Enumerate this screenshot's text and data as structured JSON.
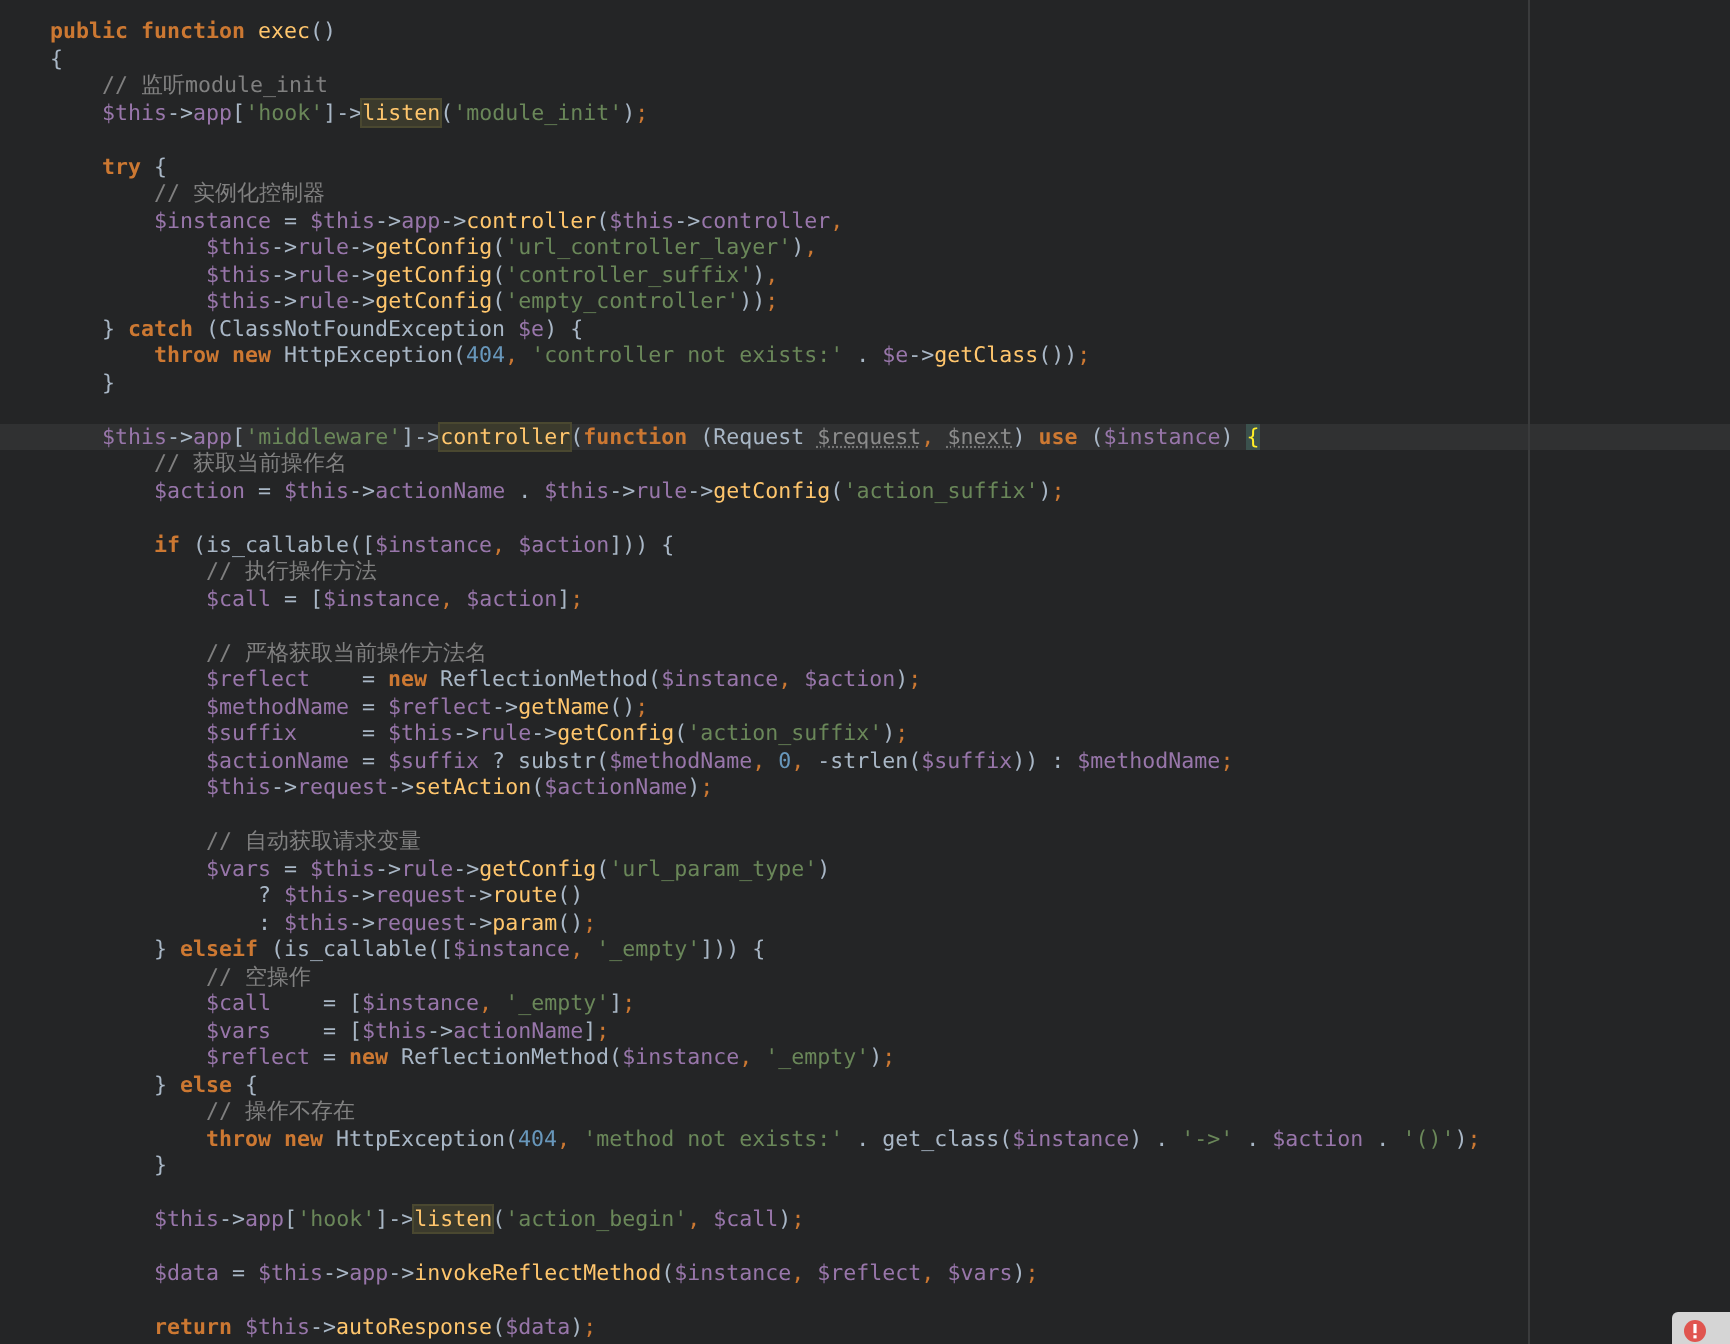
{
  "editor": {
    "lines": [
      {
        "current": false,
        "tokens": [
          {
            "kind": "kw",
            "t": "public function "
          },
          {
            "kind": "fn",
            "t": "exec"
          },
          {
            "kind": "pl",
            "t": "()"
          }
        ]
      },
      {
        "current": false,
        "tokens": [
          {
            "kind": "pl",
            "t": "{"
          }
        ]
      },
      {
        "current": false,
        "tokens": [
          {
            "kind": "cmt",
            "t": "    // 监听module_init"
          }
        ]
      },
      {
        "current": false,
        "tokens": [
          {
            "kind": "var",
            "t": "    $this"
          },
          {
            "kind": "pl",
            "t": "->"
          },
          {
            "kind": "var",
            "t": "app"
          },
          {
            "kind": "pl",
            "t": "["
          },
          {
            "kind": "str",
            "t": "'hook'"
          },
          {
            "kind": "pl",
            "t": "]->"
          },
          {
            "kind": "hl",
            "t": "listen"
          },
          {
            "kind": "pl",
            "t": "("
          },
          {
            "kind": "str",
            "t": "'module_init'"
          },
          {
            "kind": "pl",
            "t": ")"
          },
          {
            "kind": "p",
            "t": ";"
          }
        ]
      },
      {
        "current": false
      },
      {
        "current": false,
        "tokens": [
          {
            "kind": "kw",
            "t": "    try "
          },
          {
            "kind": "pl",
            "t": "{"
          }
        ]
      },
      {
        "current": false,
        "tokens": [
          {
            "kind": "cmt",
            "t": "        // 实例化控制器"
          }
        ]
      },
      {
        "current": false,
        "tokens": [
          {
            "kind": "var",
            "t": "        $instance"
          },
          {
            "kind": "pl",
            "t": " = "
          },
          {
            "kind": "var",
            "t": "$this"
          },
          {
            "kind": "pl",
            "t": "->"
          },
          {
            "kind": "var",
            "t": "app"
          },
          {
            "kind": "pl",
            "t": "->"
          },
          {
            "kind": "fn",
            "t": "controller"
          },
          {
            "kind": "pl",
            "t": "("
          },
          {
            "kind": "var",
            "t": "$this"
          },
          {
            "kind": "pl",
            "t": "->"
          },
          {
            "kind": "var",
            "t": "controller"
          },
          {
            "kind": "p",
            "t": ","
          }
        ]
      },
      {
        "current": false,
        "tokens": [
          {
            "kind": "var",
            "t": "            $this"
          },
          {
            "kind": "pl",
            "t": "->"
          },
          {
            "kind": "var",
            "t": "rule"
          },
          {
            "kind": "pl",
            "t": "->"
          },
          {
            "kind": "fn",
            "t": "getConfig"
          },
          {
            "kind": "pl",
            "t": "("
          },
          {
            "kind": "str",
            "t": "'url_controller_layer'"
          },
          {
            "kind": "pl",
            "t": ")"
          },
          {
            "kind": "p",
            "t": ","
          }
        ]
      },
      {
        "current": false,
        "tokens": [
          {
            "kind": "var",
            "t": "            $this"
          },
          {
            "kind": "pl",
            "t": "->"
          },
          {
            "kind": "var",
            "t": "rule"
          },
          {
            "kind": "pl",
            "t": "->"
          },
          {
            "kind": "fn",
            "t": "getConfig"
          },
          {
            "kind": "pl",
            "t": "("
          },
          {
            "kind": "str",
            "t": "'controller_suffix'"
          },
          {
            "kind": "pl",
            "t": ")"
          },
          {
            "kind": "p",
            "t": ","
          }
        ]
      },
      {
        "current": false,
        "tokens": [
          {
            "kind": "var",
            "t": "            $this"
          },
          {
            "kind": "pl",
            "t": "->"
          },
          {
            "kind": "var",
            "t": "rule"
          },
          {
            "kind": "pl",
            "t": "->"
          },
          {
            "kind": "fn",
            "t": "getConfig"
          },
          {
            "kind": "pl",
            "t": "("
          },
          {
            "kind": "str",
            "t": "'empty_controller'"
          },
          {
            "kind": "pl",
            "t": "))"
          },
          {
            "kind": "p",
            "t": ";"
          }
        ]
      },
      {
        "current": false,
        "tokens": [
          {
            "kind": "pl",
            "t": "    } "
          },
          {
            "kind": "kw",
            "t": "catch "
          },
          {
            "kind": "pl",
            "t": "(ClassNotFoundException "
          },
          {
            "kind": "var",
            "t": "$e"
          },
          {
            "kind": "pl",
            "t": ") {"
          }
        ]
      },
      {
        "current": false,
        "tokens": [
          {
            "kind": "kw",
            "t": "        throw new "
          },
          {
            "kind": "pl",
            "t": "HttpException("
          },
          {
            "kind": "num",
            "t": "404"
          },
          {
            "kind": "p",
            "t": ", "
          },
          {
            "kind": "str",
            "t": "'controller not exists:'"
          },
          {
            "kind": "pl",
            "t": " . "
          },
          {
            "kind": "var",
            "t": "$e"
          },
          {
            "kind": "pl",
            "t": "->"
          },
          {
            "kind": "fn",
            "t": "getClass"
          },
          {
            "kind": "pl",
            "t": "())"
          },
          {
            "kind": "p",
            "t": ";"
          }
        ]
      },
      {
        "current": false,
        "tokens": [
          {
            "kind": "pl",
            "t": "    }"
          }
        ]
      },
      {
        "current": false
      },
      {
        "current": true,
        "tokens": [
          {
            "kind": "var",
            "t": "    $this"
          },
          {
            "kind": "pl",
            "t": "->"
          },
          {
            "kind": "var",
            "t": "app"
          },
          {
            "kind": "pl",
            "t": "["
          },
          {
            "kind": "str",
            "t": "'middleware'"
          },
          {
            "kind": "pl",
            "t": "]->"
          },
          {
            "kind": "hl",
            "t": "controller"
          },
          {
            "kind": "pl",
            "t": "("
          },
          {
            "kind": "kw",
            "t": "function "
          },
          {
            "kind": "pl",
            "t": "(Request "
          },
          {
            "kind": "un",
            "t": "$request"
          },
          {
            "kind": "p",
            "t": ", "
          },
          {
            "kind": "un",
            "t": "$next"
          },
          {
            "kind": "pl",
            "t": ") "
          },
          {
            "kind": "kw",
            "t": "use "
          },
          {
            "kind": "pl",
            "t": "("
          },
          {
            "kind": "var",
            "t": "$instance"
          },
          {
            "kind": "pl",
            "t": ") "
          },
          {
            "kind": "br",
            "t": "{"
          }
        ]
      },
      {
        "current": false,
        "tokens": [
          {
            "kind": "cmt",
            "t": "        // 获取当前操作名"
          }
        ]
      },
      {
        "current": false,
        "tokens": [
          {
            "kind": "var",
            "t": "        $action"
          },
          {
            "kind": "pl",
            "t": " = "
          },
          {
            "kind": "var",
            "t": "$this"
          },
          {
            "kind": "pl",
            "t": "->"
          },
          {
            "kind": "var",
            "t": "actionName"
          },
          {
            "kind": "pl",
            "t": " . "
          },
          {
            "kind": "var",
            "t": "$this"
          },
          {
            "kind": "pl",
            "t": "->"
          },
          {
            "kind": "var",
            "t": "rule"
          },
          {
            "kind": "pl",
            "t": "->"
          },
          {
            "kind": "fn",
            "t": "getConfig"
          },
          {
            "kind": "pl",
            "t": "("
          },
          {
            "kind": "str",
            "t": "'action_suffix'"
          },
          {
            "kind": "pl",
            "t": ")"
          },
          {
            "kind": "p",
            "t": ";"
          }
        ]
      },
      {
        "current": false
      },
      {
        "current": false,
        "tokens": [
          {
            "kind": "kw",
            "t": "        if "
          },
          {
            "kind": "pl",
            "t": "(is_callable(["
          },
          {
            "kind": "var",
            "t": "$instance"
          },
          {
            "kind": "p",
            "t": ", "
          },
          {
            "kind": "var",
            "t": "$action"
          },
          {
            "kind": "pl",
            "t": "])) {"
          }
        ]
      },
      {
        "current": false,
        "tokens": [
          {
            "kind": "cmt",
            "t": "            // 执行操作方法"
          }
        ]
      },
      {
        "current": false,
        "tokens": [
          {
            "kind": "var",
            "t": "            $call"
          },
          {
            "kind": "pl",
            "t": " = ["
          },
          {
            "kind": "var",
            "t": "$instance"
          },
          {
            "kind": "p",
            "t": ", "
          },
          {
            "kind": "var",
            "t": "$action"
          },
          {
            "kind": "pl",
            "t": "]"
          },
          {
            "kind": "p",
            "t": ";"
          }
        ]
      },
      {
        "current": false
      },
      {
        "current": false,
        "tokens": [
          {
            "kind": "cmt",
            "t": "            // 严格获取当前操作方法名"
          }
        ]
      },
      {
        "current": false,
        "tokens": [
          {
            "kind": "var",
            "t": "            $reflect"
          },
          {
            "kind": "pl",
            "t": "    = "
          },
          {
            "kind": "kw",
            "t": "new "
          },
          {
            "kind": "pl",
            "t": "ReflectionMethod("
          },
          {
            "kind": "var",
            "t": "$instance"
          },
          {
            "kind": "p",
            "t": ", "
          },
          {
            "kind": "var",
            "t": "$action"
          },
          {
            "kind": "pl",
            "t": ")"
          },
          {
            "kind": "p",
            "t": ";"
          }
        ]
      },
      {
        "current": false,
        "tokens": [
          {
            "kind": "var",
            "t": "            $methodName"
          },
          {
            "kind": "pl",
            "t": " = "
          },
          {
            "kind": "var",
            "t": "$reflect"
          },
          {
            "kind": "pl",
            "t": "->"
          },
          {
            "kind": "fn",
            "t": "getName"
          },
          {
            "kind": "pl",
            "t": "()"
          },
          {
            "kind": "p",
            "t": ";"
          }
        ]
      },
      {
        "current": false,
        "tokens": [
          {
            "kind": "var",
            "t": "            $suffix"
          },
          {
            "kind": "pl",
            "t": "     = "
          },
          {
            "kind": "var",
            "t": "$this"
          },
          {
            "kind": "pl",
            "t": "->"
          },
          {
            "kind": "var",
            "t": "rule"
          },
          {
            "kind": "pl",
            "t": "->"
          },
          {
            "kind": "fn",
            "t": "getConfig"
          },
          {
            "kind": "pl",
            "t": "("
          },
          {
            "kind": "str",
            "t": "'action_suffix'"
          },
          {
            "kind": "pl",
            "t": ")"
          },
          {
            "kind": "p",
            "t": ";"
          }
        ]
      },
      {
        "current": false,
        "tokens": [
          {
            "kind": "var",
            "t": "            $actionName"
          },
          {
            "kind": "pl",
            "t": " = "
          },
          {
            "kind": "var",
            "t": "$suffix"
          },
          {
            "kind": "pl",
            "t": " ? substr("
          },
          {
            "kind": "var",
            "t": "$methodName"
          },
          {
            "kind": "p",
            "t": ", "
          },
          {
            "kind": "num",
            "t": "0"
          },
          {
            "kind": "p",
            "t": ", "
          },
          {
            "kind": "pl",
            "t": "-strlen("
          },
          {
            "kind": "var",
            "t": "$suffix"
          },
          {
            "kind": "pl",
            "t": ")) : "
          },
          {
            "kind": "var",
            "t": "$methodName"
          },
          {
            "kind": "p",
            "t": ";"
          }
        ]
      },
      {
        "current": false,
        "tokens": [
          {
            "kind": "var",
            "t": "            $this"
          },
          {
            "kind": "pl",
            "t": "->"
          },
          {
            "kind": "var",
            "t": "request"
          },
          {
            "kind": "pl",
            "t": "->"
          },
          {
            "kind": "fn",
            "t": "setAction"
          },
          {
            "kind": "pl",
            "t": "("
          },
          {
            "kind": "var",
            "t": "$actionName"
          },
          {
            "kind": "pl",
            "t": ")"
          },
          {
            "kind": "p",
            "t": ";"
          }
        ]
      },
      {
        "current": false
      },
      {
        "current": false,
        "tokens": [
          {
            "kind": "cmt",
            "t": "            // 自动获取请求变量"
          }
        ]
      },
      {
        "current": false,
        "tokens": [
          {
            "kind": "var",
            "t": "            $vars"
          },
          {
            "kind": "pl",
            "t": " = "
          },
          {
            "kind": "var",
            "t": "$this"
          },
          {
            "kind": "pl",
            "t": "->"
          },
          {
            "kind": "var",
            "t": "rule"
          },
          {
            "kind": "pl",
            "t": "->"
          },
          {
            "kind": "fn",
            "t": "getConfig"
          },
          {
            "kind": "pl",
            "t": "("
          },
          {
            "kind": "str",
            "t": "'url_param_type'"
          },
          {
            "kind": "pl",
            "t": ")"
          }
        ]
      },
      {
        "current": false,
        "tokens": [
          {
            "kind": "pl",
            "t": "                ? "
          },
          {
            "kind": "var",
            "t": "$this"
          },
          {
            "kind": "pl",
            "t": "->"
          },
          {
            "kind": "var",
            "t": "request"
          },
          {
            "kind": "pl",
            "t": "->"
          },
          {
            "kind": "fn",
            "t": "route"
          },
          {
            "kind": "pl",
            "t": "()"
          }
        ]
      },
      {
        "current": false,
        "tokens": [
          {
            "kind": "pl",
            "t": "                : "
          },
          {
            "kind": "var",
            "t": "$this"
          },
          {
            "kind": "pl",
            "t": "->"
          },
          {
            "kind": "var",
            "t": "request"
          },
          {
            "kind": "pl",
            "t": "->"
          },
          {
            "kind": "fn",
            "t": "param"
          },
          {
            "kind": "pl",
            "t": "()"
          },
          {
            "kind": "p",
            "t": ";"
          }
        ]
      },
      {
        "current": false,
        "tokens": [
          {
            "kind": "pl",
            "t": "        } "
          },
          {
            "kind": "kw",
            "t": "elseif "
          },
          {
            "kind": "pl",
            "t": "(is_callable(["
          },
          {
            "kind": "var",
            "t": "$instance"
          },
          {
            "kind": "p",
            "t": ", "
          },
          {
            "kind": "str",
            "t": "'_empty'"
          },
          {
            "kind": "pl",
            "t": "])) {"
          }
        ]
      },
      {
        "current": false,
        "tokens": [
          {
            "kind": "cmt",
            "t": "            // 空操作"
          }
        ]
      },
      {
        "current": false,
        "tokens": [
          {
            "kind": "var",
            "t": "            $call"
          },
          {
            "kind": "pl",
            "t": "    = ["
          },
          {
            "kind": "var",
            "t": "$instance"
          },
          {
            "kind": "p",
            "t": ", "
          },
          {
            "kind": "str",
            "t": "'_empty'"
          },
          {
            "kind": "pl",
            "t": "]"
          },
          {
            "kind": "p",
            "t": ";"
          }
        ]
      },
      {
        "current": false,
        "tokens": [
          {
            "kind": "var",
            "t": "            $vars"
          },
          {
            "kind": "pl",
            "t": "    = ["
          },
          {
            "kind": "var",
            "t": "$this"
          },
          {
            "kind": "pl",
            "t": "->"
          },
          {
            "kind": "var",
            "t": "actionName"
          },
          {
            "kind": "pl",
            "t": "]"
          },
          {
            "kind": "p",
            "t": ";"
          }
        ]
      },
      {
        "current": false,
        "tokens": [
          {
            "kind": "var",
            "t": "            $reflect"
          },
          {
            "kind": "pl",
            "t": " = "
          },
          {
            "kind": "kw",
            "t": "new "
          },
          {
            "kind": "pl",
            "t": "ReflectionMethod("
          },
          {
            "kind": "var",
            "t": "$instance"
          },
          {
            "kind": "p",
            "t": ", "
          },
          {
            "kind": "str",
            "t": "'_empty'"
          },
          {
            "kind": "pl",
            "t": ")"
          },
          {
            "kind": "p",
            "t": ";"
          }
        ]
      },
      {
        "current": false,
        "tokens": [
          {
            "kind": "pl",
            "t": "        } "
          },
          {
            "kind": "kw",
            "t": "else "
          },
          {
            "kind": "pl",
            "t": "{"
          }
        ]
      },
      {
        "current": false,
        "tokens": [
          {
            "kind": "cmt",
            "t": "            // 操作不存在"
          }
        ]
      },
      {
        "current": false,
        "tokens": [
          {
            "kind": "kw",
            "t": "            throw new "
          },
          {
            "kind": "pl",
            "t": "HttpException("
          },
          {
            "kind": "num",
            "t": "404"
          },
          {
            "kind": "p",
            "t": ", "
          },
          {
            "kind": "str",
            "t": "'method not exists:'"
          },
          {
            "kind": "pl",
            "t": " . get_class("
          },
          {
            "kind": "var",
            "t": "$instance"
          },
          {
            "kind": "pl",
            "t": ") . "
          },
          {
            "kind": "str",
            "t": "'->'"
          },
          {
            "kind": "pl",
            "t": " . "
          },
          {
            "kind": "var",
            "t": "$action"
          },
          {
            "kind": "pl",
            "t": " . "
          },
          {
            "kind": "str",
            "t": "'()'"
          },
          {
            "kind": "pl",
            "t": ")"
          },
          {
            "kind": "p",
            "t": ";"
          }
        ]
      },
      {
        "current": false,
        "tokens": [
          {
            "kind": "pl",
            "t": "        }"
          }
        ]
      },
      {
        "current": false
      },
      {
        "current": false,
        "tokens": [
          {
            "kind": "var",
            "t": "        $this"
          },
          {
            "kind": "pl",
            "t": "->"
          },
          {
            "kind": "var",
            "t": "app"
          },
          {
            "kind": "pl",
            "t": "["
          },
          {
            "kind": "str",
            "t": "'hook'"
          },
          {
            "kind": "pl",
            "t": "]->"
          },
          {
            "kind": "hl",
            "t": "listen"
          },
          {
            "kind": "pl",
            "t": "("
          },
          {
            "kind": "str",
            "t": "'action_begin'"
          },
          {
            "kind": "p",
            "t": ", "
          },
          {
            "kind": "var",
            "t": "$call"
          },
          {
            "kind": "pl",
            "t": ")"
          },
          {
            "kind": "p",
            "t": ";"
          }
        ]
      },
      {
        "current": false
      },
      {
        "current": false,
        "tokens": [
          {
            "kind": "var",
            "t": "        $data"
          },
          {
            "kind": "pl",
            "t": " = "
          },
          {
            "kind": "var",
            "t": "$this"
          },
          {
            "kind": "pl",
            "t": "->"
          },
          {
            "kind": "var",
            "t": "app"
          },
          {
            "kind": "pl",
            "t": "->"
          },
          {
            "kind": "fn",
            "t": "invokeReflectMethod"
          },
          {
            "kind": "pl",
            "t": "("
          },
          {
            "kind": "var",
            "t": "$instance"
          },
          {
            "kind": "p",
            "t": ", "
          },
          {
            "kind": "var",
            "t": "$reflect"
          },
          {
            "kind": "p",
            "t": ", "
          },
          {
            "kind": "var",
            "t": "$vars"
          },
          {
            "kind": "pl",
            "t": ")"
          },
          {
            "kind": "p",
            "t": ";"
          }
        ]
      },
      {
        "current": false
      },
      {
        "current": false,
        "tokens": [
          {
            "kind": "kw",
            "t": "        return "
          },
          {
            "kind": "var",
            "t": "$this"
          },
          {
            "kind": "pl",
            "t": "->"
          },
          {
            "kind": "fn",
            "t": "autoResponse"
          },
          {
            "kind": "pl",
            "t": "("
          },
          {
            "kind": "var",
            "t": "$data"
          },
          {
            "kind": "pl",
            "t": ")"
          },
          {
            "kind": "p",
            "t": ";"
          }
        ]
      }
    ]
  }
}
